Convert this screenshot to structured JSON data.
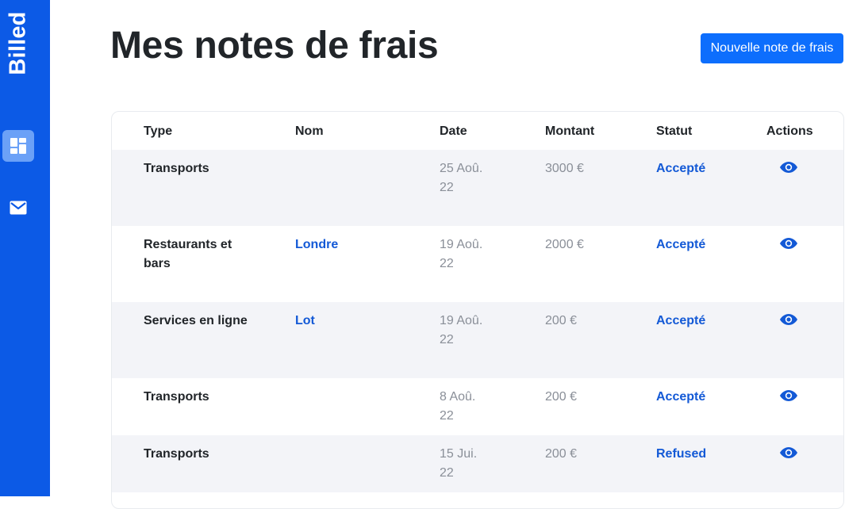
{
  "app": {
    "brand": "Billed"
  },
  "sidebar": {
    "items": [
      {
        "icon": "dashboard-icon",
        "active": true
      },
      {
        "icon": "mail-icon",
        "active": false
      }
    ]
  },
  "header": {
    "title": "Mes notes de frais",
    "new_button_label": "Nouvelle note de frais"
  },
  "table": {
    "columns": [
      "Type",
      "Nom",
      "Date",
      "Montant",
      "Statut",
      "Actions"
    ],
    "rows": [
      {
        "type": "Transports",
        "name": "",
        "date": "25 Aoû. 22",
        "amount": "3000 €",
        "status": "Accepté"
      },
      {
        "type": "Restaurants et bars",
        "name": "Londre",
        "date": "19 Aoû. 22",
        "amount": "2000 €",
        "status": "Accepté"
      },
      {
        "type": "Services en ligne",
        "name": "Lot",
        "date": "19 Aoû. 22",
        "amount": "200 €",
        "status": "Accepté"
      },
      {
        "type": "Transports",
        "name": "",
        "date": "8 Aoû. 22",
        "amount": "200 €",
        "status": "Accepté"
      },
      {
        "type": "Transports",
        "name": "",
        "date": "15 Jui. 22",
        "amount": "200 €",
        "status": "Refused"
      }
    ]
  },
  "colors": {
    "sidebar": "#0c5ae6",
    "accent": "#0d6efd",
    "link": "#1359d6",
    "row_shade": "#f3f4f8"
  }
}
